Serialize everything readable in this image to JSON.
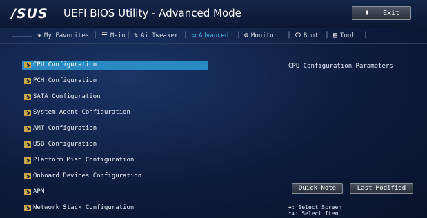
{
  "header": {
    "brand": "/SUS",
    "title": "UEFI BIOS Utility - Advanced Mode",
    "exit_label": "Exit"
  },
  "tabs": [
    {
      "label": "My Favorites",
      "icon": "star-icon",
      "active": false
    },
    {
      "label": "Main",
      "icon": "list-icon",
      "active": false
    },
    {
      "label": "Ai Tweaker",
      "icon": "tweak-icon",
      "active": false
    },
    {
      "label": "Advanced",
      "icon": "advanced-icon",
      "active": true
    },
    {
      "label": "Monitor",
      "icon": "monitor-icon",
      "active": false
    },
    {
      "label": "Boot",
      "icon": "power-icon",
      "active": false
    },
    {
      "label": "Tool",
      "icon": "tool-icon",
      "active": false
    }
  ],
  "menu": {
    "items": [
      "CPU Configuration",
      "PCH Configuration",
      "SATA Configuration",
      "System Agent Configuration",
      "AMT Configuration",
      "USB Configuration",
      "Platform Misc Configuration",
      "Onboard Devices Configuration",
      "APM",
      "Network Stack Configuration"
    ],
    "selected_index": 0
  },
  "help": {
    "text": "CPU Configuration Parameters"
  },
  "buttons": {
    "quick_note": "Quick Note",
    "last_modified": "Last Modified"
  },
  "hints": [
    {
      "key": "↔",
      "text": ": Select Screen"
    },
    {
      "key": "↑↓",
      "text": ": Select Item"
    }
  ],
  "colors": {
    "accent": "#2a8bc4",
    "active_tab": "#4fb6e8",
    "background": "#0c1c3d"
  }
}
